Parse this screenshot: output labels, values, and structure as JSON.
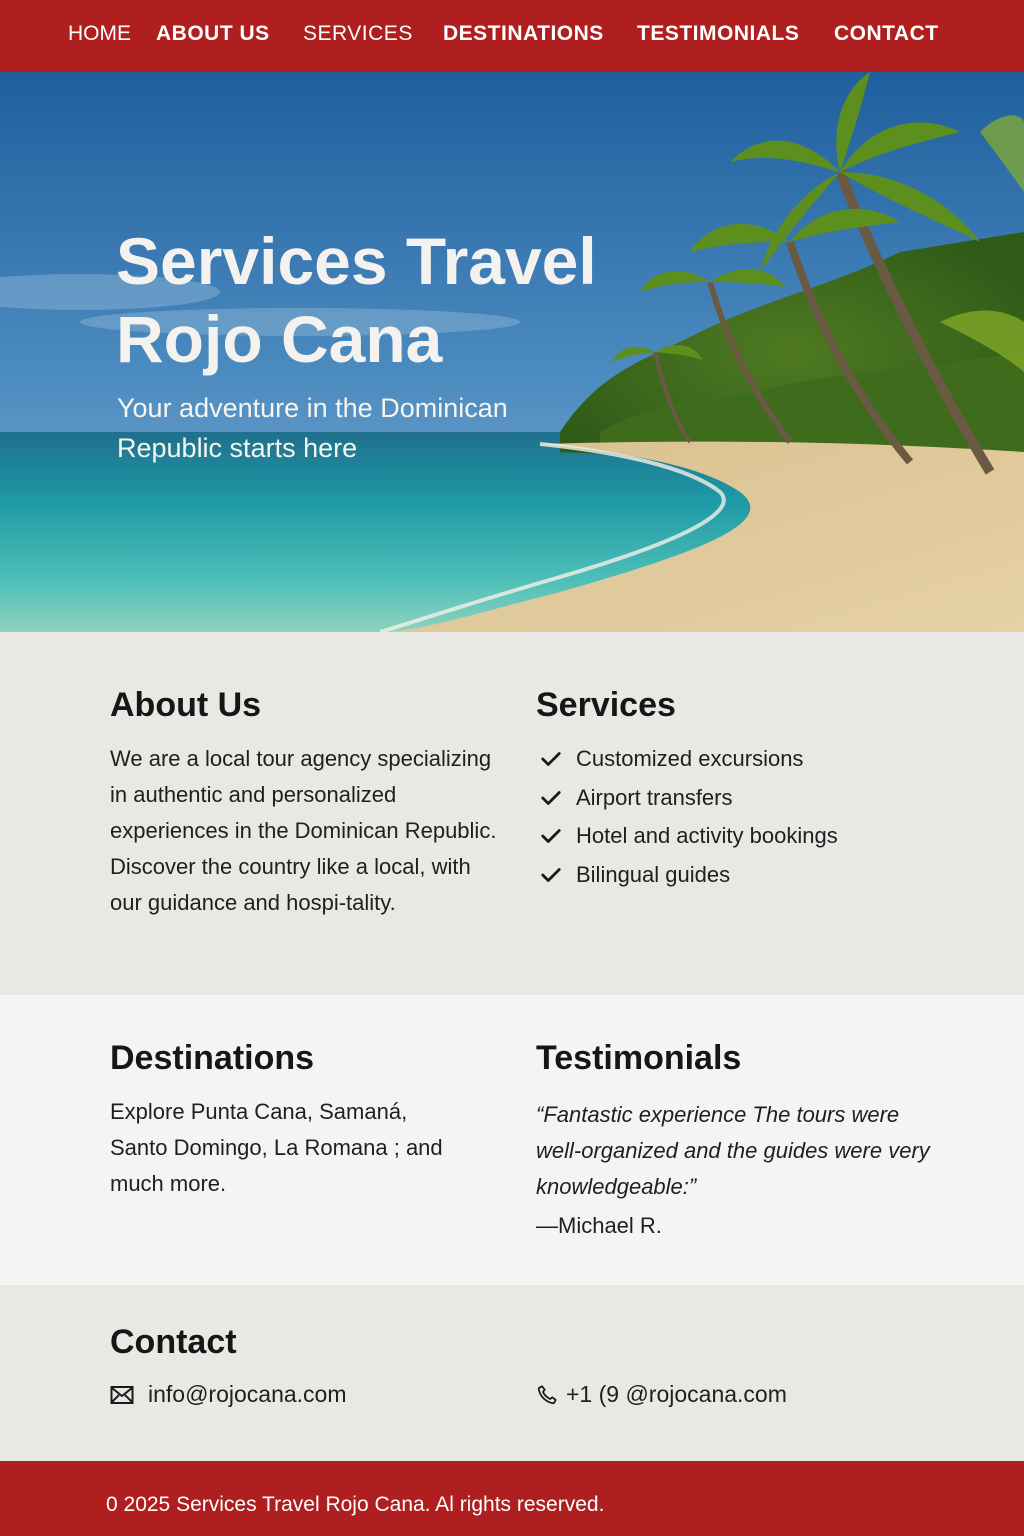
{
  "nav": {
    "items": [
      {
        "label": "HOME"
      },
      {
        "label": "ABOUT US"
      },
      {
        "label": "SERVICES"
      },
      {
        "label": "DESTINATIONS"
      },
      {
        "label": "TESTIMONIALS"
      },
      {
        "label": "CONTACT"
      }
    ]
  },
  "hero": {
    "title": "Services Travel Rojo Cana",
    "subtitle": "Your adventure in the Dominican Republic starts here"
  },
  "about": {
    "heading": "About Us",
    "text": "We are a local tour agency specializing in authentic and personalized experiences in the Dominican Republic. Discover the country like a local, with our guidance and hospi-tality."
  },
  "services": {
    "heading": "Services",
    "items": [
      {
        "label": "Customized excursions"
      },
      {
        "label": "Airport transfers"
      },
      {
        "label": "Hotel and activity bookings"
      },
      {
        "label": "Bilingual guides"
      }
    ]
  },
  "destinations": {
    "heading": "Destinations",
    "text": "Explore Punta Cana, Samaná, Santo Domingo, La Romana ; and much more."
  },
  "testimonials": {
    "heading": "Testimonials",
    "quote": "“Fantastic experience The tours were well-organized and the guides were very knowledgeable:”",
    "author": "—Michael R."
  },
  "contact": {
    "heading": "Contact",
    "email": "info@rojocana.com",
    "phone": "+1 (9 @rojocana.com"
  },
  "footer": {
    "text": "0 2025 Services Travel Rojo Cana. Al rights reserved."
  },
  "colors": {
    "brand_red": "#b01f1f",
    "section_gray": "#e9e8e5",
    "section_light": "#f4f4f2"
  }
}
